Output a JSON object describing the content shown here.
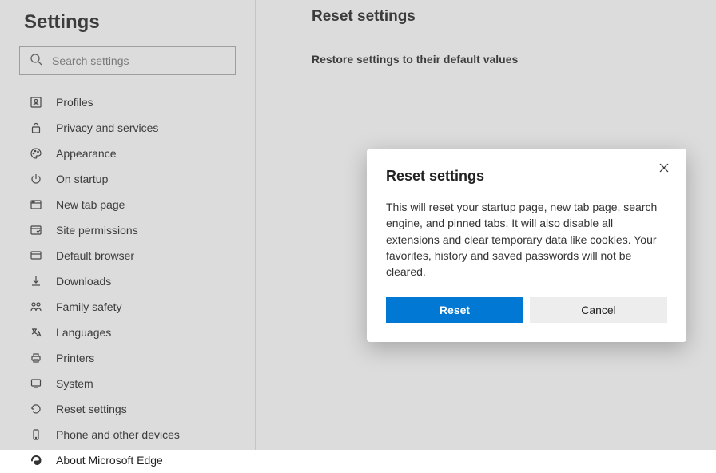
{
  "sidebar": {
    "title": "Settings",
    "search_placeholder": "Search settings",
    "items": [
      {
        "label": "Profiles"
      },
      {
        "label": "Privacy and services"
      },
      {
        "label": "Appearance"
      },
      {
        "label": "On startup"
      },
      {
        "label": "New tab page"
      },
      {
        "label": "Site permissions"
      },
      {
        "label": "Default browser"
      },
      {
        "label": "Downloads"
      },
      {
        "label": "Family safety"
      },
      {
        "label": "Languages"
      },
      {
        "label": "Printers"
      },
      {
        "label": "System"
      },
      {
        "label": "Reset settings"
      },
      {
        "label": "Phone and other devices"
      },
      {
        "label": "About Microsoft Edge"
      }
    ]
  },
  "main": {
    "title": "Reset settings",
    "restore_text": "Restore settings to their default values"
  },
  "dialog": {
    "title": "Reset settings",
    "body": "This will reset your startup page, new tab page, search engine, and pinned tabs. It will also disable all extensions and clear temporary data like cookies. Your favorites, history and saved passwords will not be cleared.",
    "reset_label": "Reset",
    "cancel_label": "Cancel"
  }
}
